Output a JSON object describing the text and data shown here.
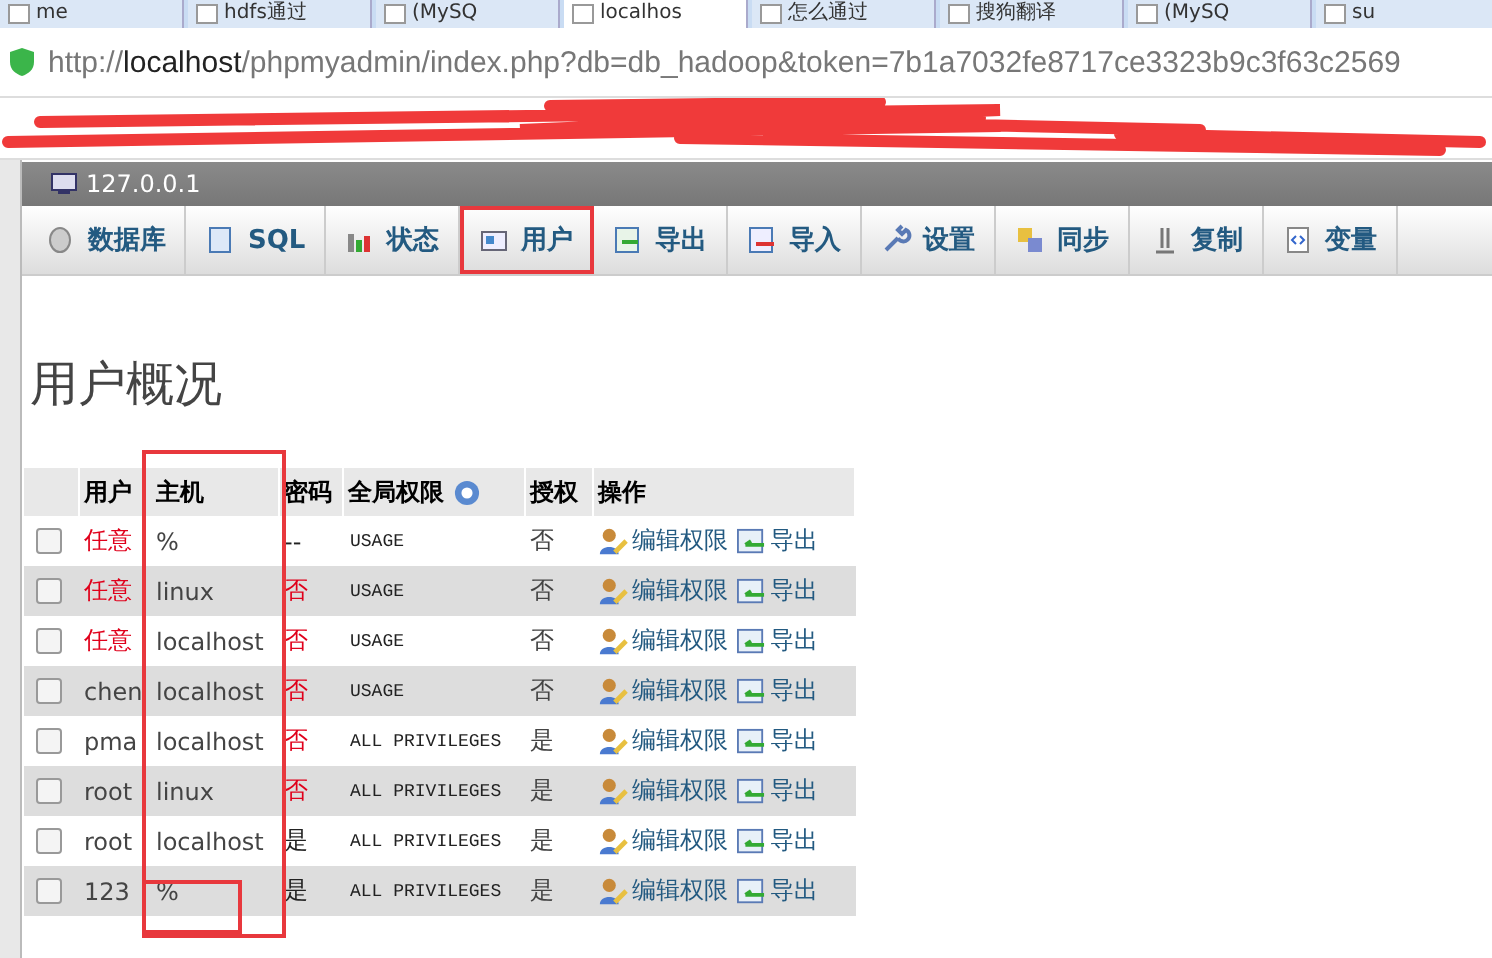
{
  "browser_tabs": [
    {
      "title": "me",
      "selected": false
    },
    {
      "title": "hdfs通过",
      "selected": false
    },
    {
      "title": "(MySQ",
      "selected": false
    },
    {
      "title": "localhos",
      "selected": true
    },
    {
      "title": "怎么通过",
      "selected": false
    },
    {
      "title": "搜狗翻译",
      "selected": false
    },
    {
      "title": "(MySQ",
      "selected": false
    },
    {
      "title": "su",
      "selected": false
    }
  ],
  "address": {
    "scheme": "http://",
    "host": "localhost",
    "path": "/phpmyadmin/index.php?db=db_hadoop&token=7b1a7032fe8717ce3323b9c3f63c2569"
  },
  "server": "127.0.0.1",
  "nav_tabs": [
    {
      "label": "数据库",
      "marked": false
    },
    {
      "label": "SQL",
      "marked": false
    },
    {
      "label": "状态",
      "marked": false
    },
    {
      "label": "用户",
      "marked": true
    },
    {
      "label": "导出",
      "marked": false
    },
    {
      "label": "导入",
      "marked": false
    },
    {
      "label": "设置",
      "marked": false
    },
    {
      "label": "同步",
      "marked": false
    },
    {
      "label": "复制",
      "marked": false
    },
    {
      "label": "变量",
      "marked": false
    }
  ],
  "heading": "用户概况",
  "table": {
    "columns": [
      "用户",
      "主机",
      "密码",
      "全局权限",
      "授权",
      "操作"
    ],
    "rows": [
      {
        "user": "任意",
        "anonymous": true,
        "host": "%",
        "password": "--",
        "password_warn": false,
        "privileges": "USAGE",
        "grant": "否",
        "edit": "编辑权限",
        "export": "导出",
        "checked": false
      },
      {
        "user": "任意",
        "anonymous": true,
        "host": "linux",
        "password": "否",
        "password_warn": true,
        "privileges": "USAGE",
        "grant": "否",
        "edit": "编辑权限",
        "export": "导出",
        "checked": false
      },
      {
        "user": "任意",
        "anonymous": true,
        "host": "localhost",
        "password": "否",
        "password_warn": true,
        "privileges": "USAGE",
        "grant": "否",
        "edit": "编辑权限",
        "export": "导出",
        "checked": false
      },
      {
        "user": "chen",
        "anonymous": false,
        "host": "localhost",
        "password": "否",
        "password_warn": true,
        "privileges": "USAGE",
        "grant": "否",
        "edit": "编辑权限",
        "export": "导出",
        "checked": false
      },
      {
        "user": "pma",
        "anonymous": false,
        "host": "localhost",
        "password": "否",
        "password_warn": true,
        "privileges": "ALL PRIVILEGES",
        "grant": "是",
        "edit": "编辑权限",
        "export": "导出",
        "checked": false
      },
      {
        "user": "root",
        "anonymous": false,
        "host": "linux",
        "password": "否",
        "password_warn": true,
        "privileges": "ALL PRIVILEGES",
        "grant": "是",
        "edit": "编辑权限",
        "export": "导出",
        "checked": false
      },
      {
        "user": "root",
        "anonymous": false,
        "host": "localhost",
        "password": "是",
        "password_warn": false,
        "privileges": "ALL PRIVILEGES",
        "grant": "是",
        "edit": "编辑权限",
        "export": "导出",
        "checked": false
      },
      {
        "user": "123",
        "anonymous": false,
        "host": "%",
        "password": "是",
        "password_warn": false,
        "privileges": "ALL PRIVILEGES",
        "grant": "是",
        "edit": "编辑权限",
        "export": "导出",
        "checked": false
      }
    ]
  }
}
